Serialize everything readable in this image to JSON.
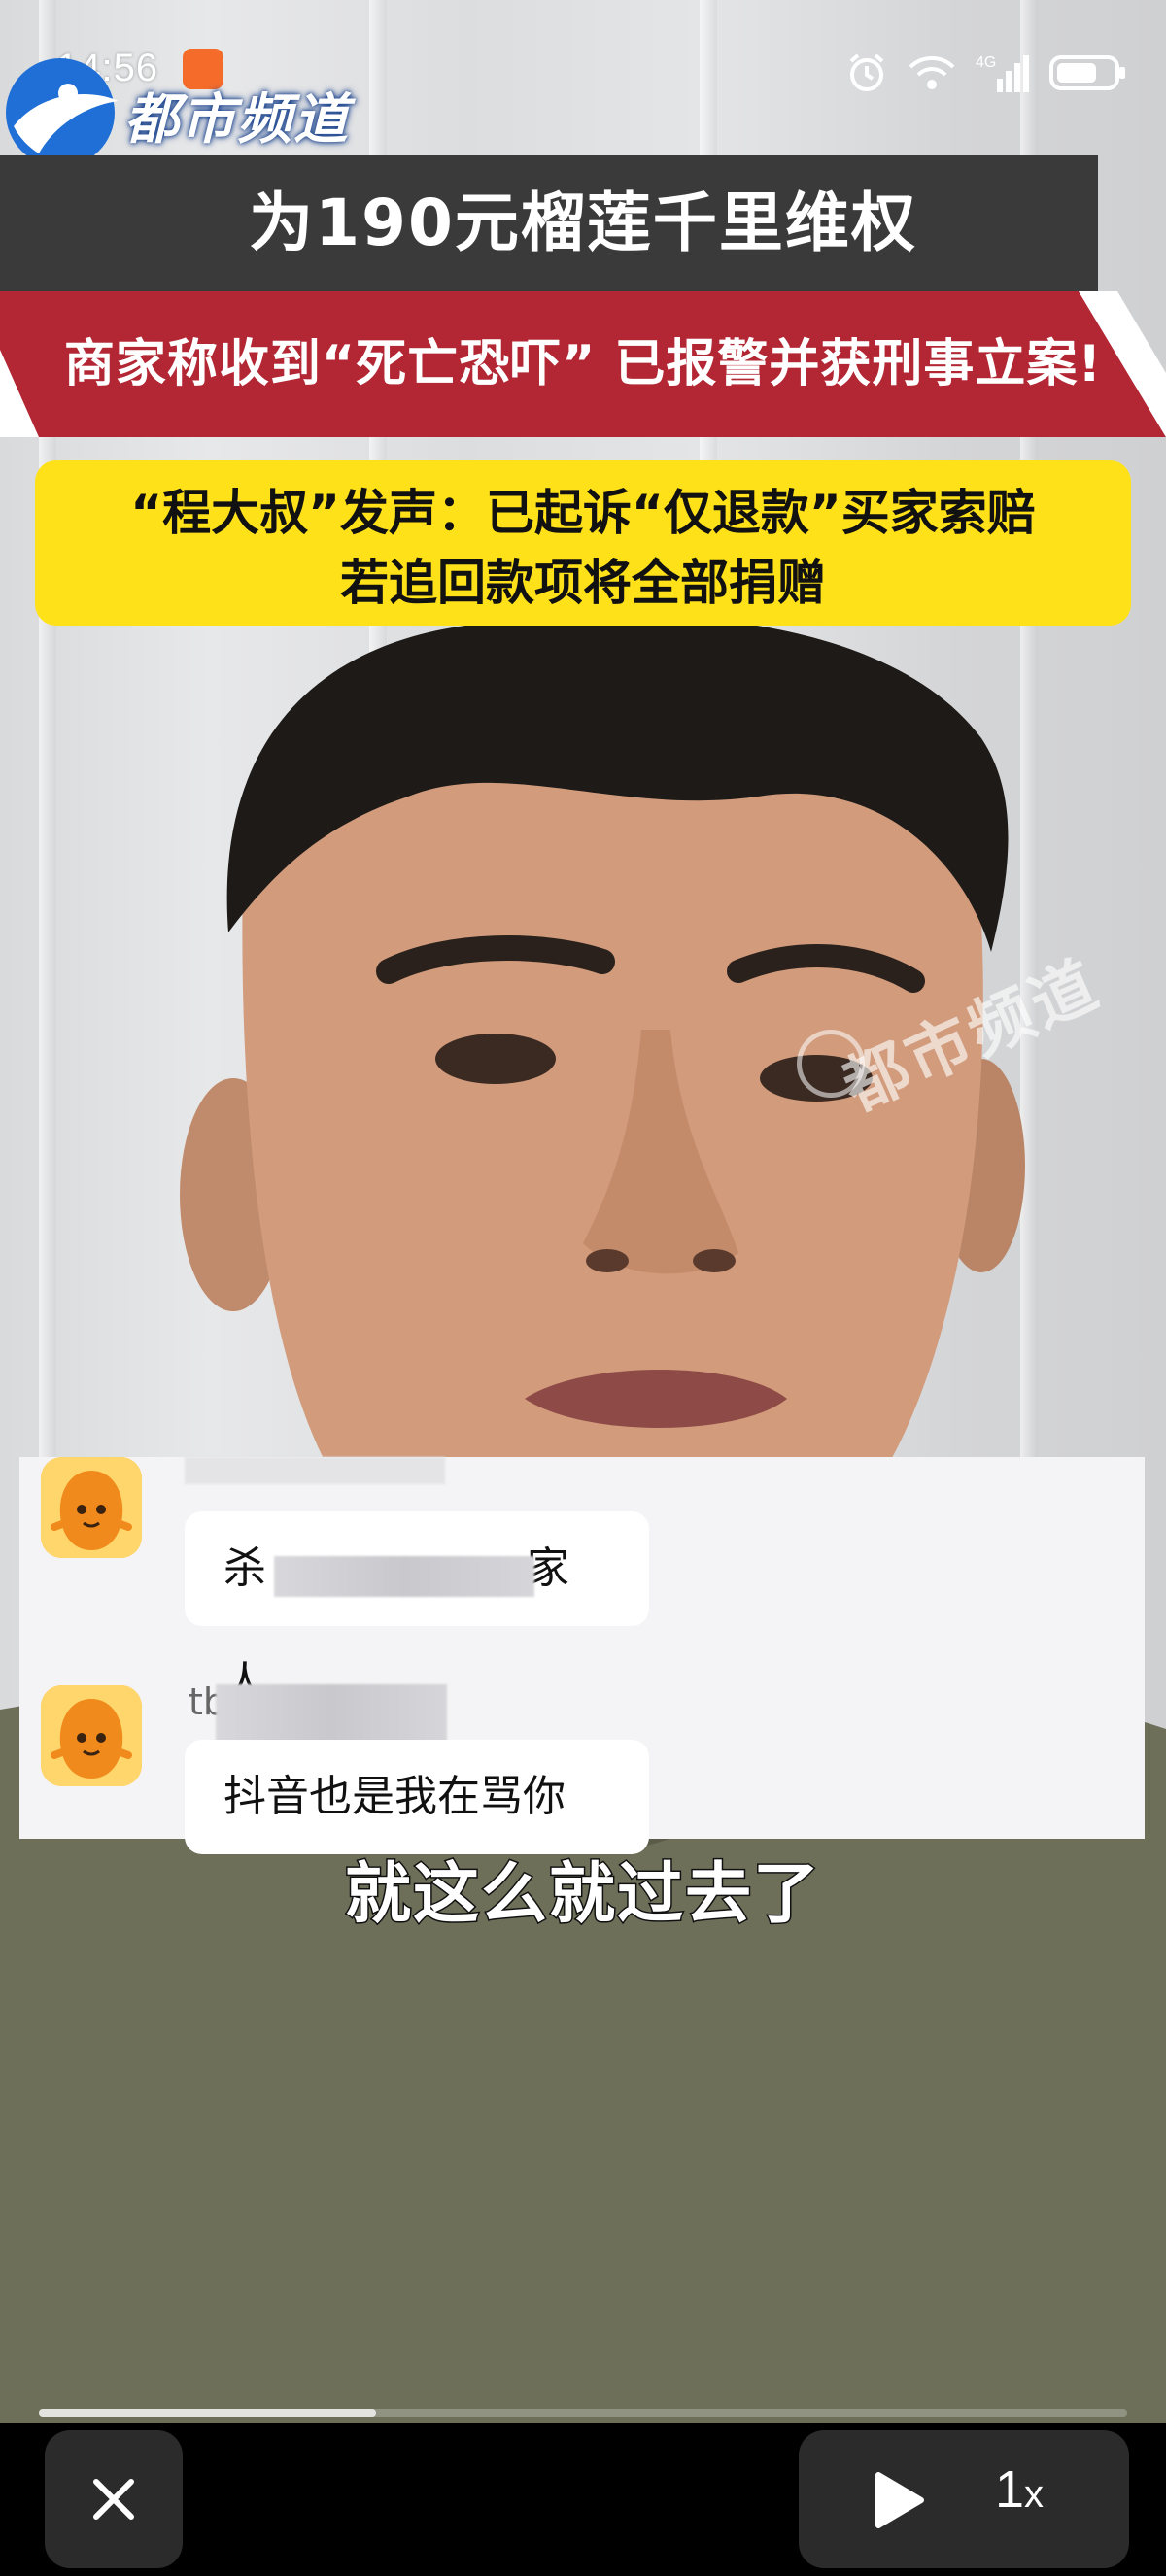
{
  "status_bar": {
    "time": "14:56",
    "network": "4G",
    "icons": [
      "alarm-icon",
      "wifi-icon",
      "signal-icon",
      "battery-icon"
    ]
  },
  "channel_logo": {
    "name": "都市频道"
  },
  "headline": {
    "title": "为190元榴莲千里维权",
    "subtitle": "商家称收到“死亡恐吓” 已报警并获刑事立案!"
  },
  "caption": {
    "line1": "“程大叔”发声：已起诉“仅退款”买家索赔",
    "line2": "若追回款项将全部捐赠"
  },
  "watermark": {
    "text": "都市频道"
  },
  "chat": {
    "messages": [
      {
        "username": "",
        "text_start": "杀",
        "text_end": "家人"
      },
      {
        "username": "tb",
        "text": "抖音也是我在骂你"
      }
    ]
  },
  "video_subtitle": "就这么就过去了",
  "playback": {
    "progress": 0.31,
    "speed": "1",
    "speed_unit": "x"
  },
  "colors": {
    "banner_dark": "#3a3a3a",
    "banner_red": "#b32633",
    "caption_yellow": "#ffe11a",
    "control_bg": "#2b2b2b"
  }
}
